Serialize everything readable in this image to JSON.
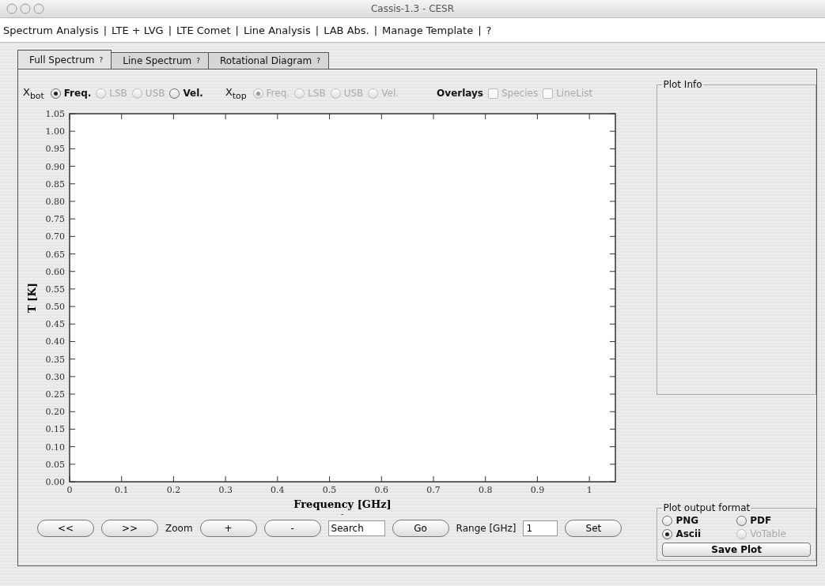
{
  "window": {
    "title": "Cassis-1.3 - CESR"
  },
  "menu": [
    {
      "label": "Spectrum Analysis",
      "separator": "|"
    },
    {
      "label": "LTE + LVG",
      "separator": "|"
    },
    {
      "label": "LTE Comet",
      "separator": "|"
    },
    {
      "label": "Line Analysis",
      "separator": "|"
    },
    {
      "label": "LAB Abs.",
      "separator": "|"
    },
    {
      "label": "Manage Template",
      "separator": "|"
    },
    {
      "label": "?"
    }
  ],
  "tabs": [
    {
      "label": "Full Spectrum",
      "help": "?",
      "selected": true
    },
    {
      "label": "Line Spectrum",
      "help": "?",
      "selected": false
    },
    {
      "label": "Rotational Diagram",
      "help": "?",
      "selected": false
    }
  ],
  "x_groups": [
    {
      "label": "X$_{bot}$",
      "options": [
        {
          "label": "Freq.",
          "selected": true,
          "disabled": false
        },
        {
          "label": "LSB",
          "selected": false,
          "disabled": true
        },
        {
          "label": "USB",
          "selected": false,
          "disabled": true
        },
        {
          "label": "Vel.",
          "selected": false,
          "disabled": false
        }
      ]
    },
    {
      "label": "X$_{top}$",
      "options": [
        {
          "label": "Freq.",
          "selected": true,
          "disabled": true
        },
        {
          "label": "LSB",
          "selected": false,
          "disabled": true
        },
        {
          "label": "USB",
          "selected": false,
          "disabled": true
        },
        {
          "label": "Vel.",
          "selected": false,
          "disabled": true
        }
      ]
    }
  ],
  "overlays": {
    "label": "Overlays",
    "options": [
      {
        "label": "Species",
        "checked": false,
        "disabled": true
      },
      {
        "label": "LineList",
        "checked": false,
        "disabled": true
      }
    ]
  },
  "plot": {
    "chart_data": {
      "type": "line",
      "xlabel": "Frequency [GHz]",
      "ylabel": "T [K]",
      "xlim": [
        0,
        1.05
      ],
      "ylim": [
        0,
        1.05
      ],
      "xticks": [
        {
          "value": 0,
          "label": "0"
        },
        0.1,
        0.2,
        0.3,
        0.4,
        0.5,
        0.6,
        0.7,
        0.8,
        0.9,
        {
          "value": 1,
          "label": "1"
        }
      ],
      "yticks": [
        {
          "value": 0,
          "label": "0.00"
        },
        {
          "value": 0.05,
          "label": "0.05"
        },
        {
          "value": 0.1,
          "label": "0.10"
        },
        {
          "value": 0.15,
          "label": "0.15"
        },
        {
          "value": 0.2,
          "label": "0.20"
        },
        {
          "value": 0.25,
          "label": "0.25"
        },
        {
          "value": 0.3,
          "label": "0.30"
        },
        {
          "value": 0.35,
          "label": "0.35"
        },
        {
          "value": 0.4,
          "label": "0.40"
        },
        {
          "value": 0.45,
          "label": "0.45"
        },
        {
          "value": 0.5,
          "label": "0.50"
        },
        {
          "value": 0.55,
          "label": "0.55"
        },
        {
          "value": 0.6,
          "label": "0.60"
        },
        {
          "value": 0.65,
          "label": "0.65"
        },
        {
          "value": 0.7,
          "label": "0.70"
        },
        {
          "value": 0.75,
          "label": "0.75"
        },
        {
          "value": 0.8,
          "label": "0.80"
        },
        {
          "value": 0.85,
          "label": "0.85"
        },
        {
          "value": 0.9,
          "label": "0.90"
        },
        {
          "value": 0.95,
          "label": "0.95"
        },
        {
          "value": 1,
          "label": "1.00"
        },
        {
          "value": 1.05,
          "label": "1.05"
        }
      ]
    },
    "sub_mark": "-"
  },
  "toolbar": [
    {
      "kind": "button",
      "label": "<<"
    },
    {
      "kind": "button",
      "label": ">>"
    },
    {
      "kind": "label",
      "label": "Zoom"
    },
    {
      "kind": "button",
      "label": "+"
    },
    {
      "kind": "button",
      "label": "-"
    },
    {
      "kind": "field",
      "value": "Search"
    },
    {
      "kind": "button",
      "label": "Go"
    },
    {
      "kind": "label",
      "label": "Range [GHz]"
    },
    {
      "kind": "field",
      "value": "1"
    },
    {
      "kind": "button",
      "label": "Set"
    }
  ],
  "plot_info": {
    "title": "Plot Info"
  },
  "output_format": {
    "title": "Plot output format",
    "options": [
      {
        "label": "PNG",
        "selected": false,
        "disabled": false
      },
      {
        "label": "PDF",
        "selected": false,
        "disabled": false
      },
      {
        "label": "Ascii",
        "selected": true,
        "disabled": false
      },
      {
        "label": "VoTable",
        "selected": false,
        "disabled": true
      }
    ],
    "save": "Save Plot"
  }
}
